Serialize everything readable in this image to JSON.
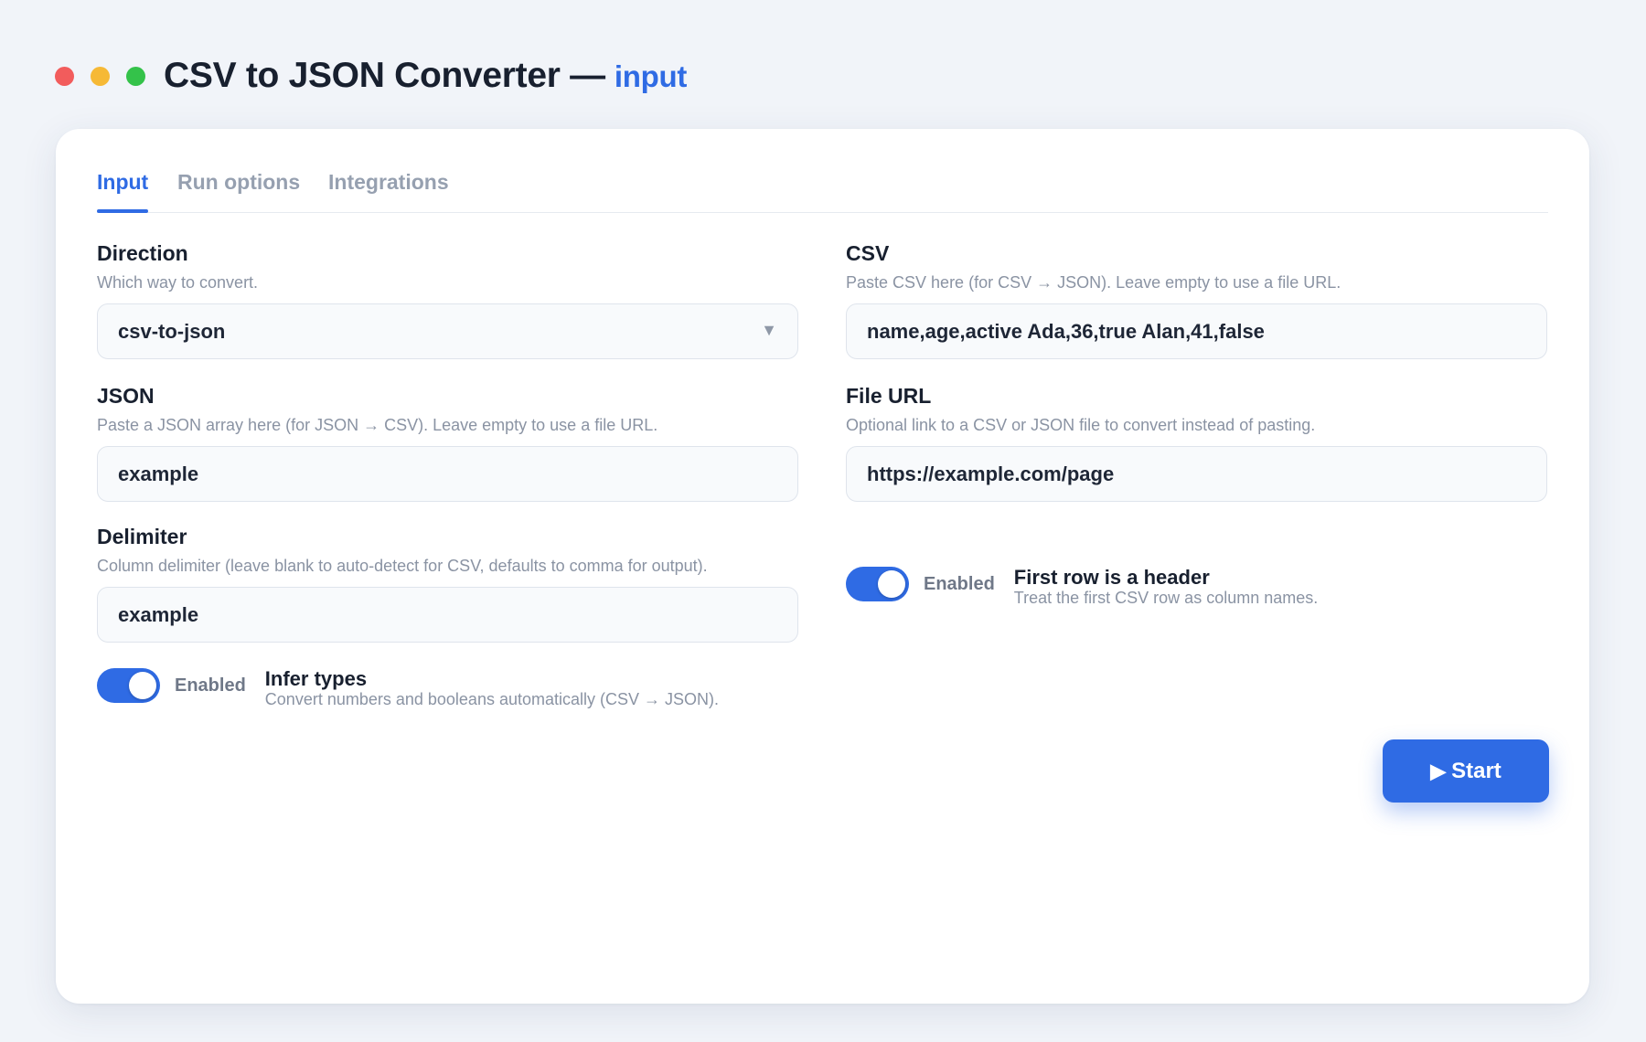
{
  "window": {
    "title": "CSV to JSON Converter —",
    "subtitle": "input",
    "controls": [
      "close",
      "minimize",
      "maximize"
    ]
  },
  "tabs": [
    {
      "label": "Input",
      "active": true
    },
    {
      "label": "Run options",
      "active": false
    },
    {
      "label": "Integrations",
      "active": false
    }
  ],
  "fields": {
    "direction": {
      "label": "Direction",
      "help": "Which way to convert.",
      "value": "csv-to-json",
      "arrow": "▼"
    },
    "csv": {
      "label": "CSV",
      "help": "Paste CSV here (for CSV → JSON). Leave empty to use a file URL.",
      "value": "name,age,active Ada,36,true Alan,41,false"
    },
    "json": {
      "label": "JSON",
      "help": "Paste a JSON array here (for JSON → CSV). Leave empty to use a file URL.",
      "value": "example"
    },
    "file_url": {
      "label": "File URL",
      "help": "Optional link to a CSV or JSON file to convert instead of pasting.",
      "value": "https://example.com/page"
    },
    "delimiter": {
      "label": "Delimiter",
      "help": "Column delimiter (leave blank to auto-detect for CSV, defaults to comma for output).",
      "value": "example"
    }
  },
  "toggles": {
    "first_row_header": {
      "state": "Enabled",
      "on": true,
      "title": "First row is a header",
      "desc": "Treat the first CSV row as column names."
    },
    "infer_types": {
      "state": "Enabled",
      "on": true,
      "title": "Infer types",
      "desc": "Convert numbers and booleans automatically (CSV → JSON)."
    }
  },
  "actions": {
    "start_label": "Start",
    "start_icon": "▶"
  },
  "colors": {
    "accent": "#2f6be4",
    "background": "#f1f4f9",
    "close": "#f25c5c",
    "minimize": "#f6b936",
    "maximize": "#34c24a"
  }
}
